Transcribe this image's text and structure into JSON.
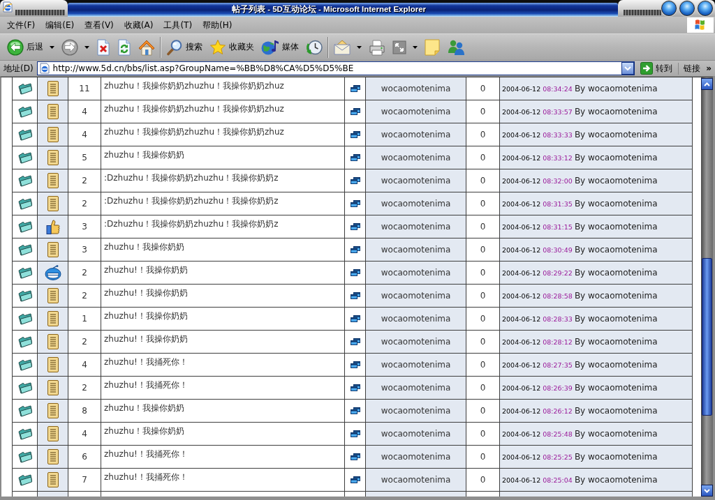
{
  "window": {
    "title": "帖子列表 - 5D互动论坛 - Microsoft Internet Explorer"
  },
  "menu_bar": {
    "items": [
      "文件(F)",
      "编辑(E)",
      "查看(V)",
      "收藏(A)",
      "工具(T)",
      "帮助(H)"
    ]
  },
  "toolbar": {
    "items": [
      {
        "kind": "back",
        "label": "后退",
        "dropdown": true,
        "disabled": false
      },
      {
        "kind": "forward",
        "dropdown": true,
        "disabled": true
      },
      {
        "kind": "stop",
        "dropdown": false,
        "disabled": false
      },
      {
        "kind": "refresh",
        "dropdown": false,
        "disabled": false
      },
      {
        "kind": "home",
        "dropdown": false,
        "disabled": false
      },
      {
        "kind": "separator"
      },
      {
        "kind": "search",
        "label": "搜索",
        "dropdown": false,
        "disabled": false
      },
      {
        "kind": "favorites",
        "label": "收藏夹",
        "dropdown": false,
        "disabled": false
      },
      {
        "kind": "media",
        "label": "媒体",
        "dropdown": false,
        "disabled": false
      },
      {
        "kind": "history",
        "dropdown": false,
        "disabled": false
      },
      {
        "kind": "separator"
      },
      {
        "kind": "mail",
        "dropdown": true,
        "disabled": false
      },
      {
        "kind": "print",
        "dropdown": false,
        "disabled": false
      },
      {
        "kind": "expand",
        "dropdown": true,
        "disabled": true
      },
      {
        "kind": "note",
        "dropdown": false,
        "disabled": false
      },
      {
        "kind": "messenger",
        "dropdown": false,
        "disabled": false
      }
    ]
  },
  "address_bar": {
    "label": "地址(D)",
    "url": "http://www.5d.cn/bbs/list.asp?GroupName=%BB%D8%CA%D5%D5%BE",
    "go_label": "转到",
    "links_label": "链接",
    "more_links": "»"
  },
  "topics": [
    {
      "kind": "normal",
      "column_3": "11",
      "title": "zhuzhu！我操你奶奶zhuzhu！我操你奶奶zhuz",
      "author": "wocaomotenima",
      "column_7": "0",
      "column_8": {
        "date": "2004-06-12",
        "time": "08:34:24",
        "text": "By wocaomotenima"
      }
    },
    {
      "kind": "normal",
      "column_3": "4",
      "title": "zhuzhu！我操你奶奶zhuzhu！我操你奶奶zhuz",
      "author": "wocaomotenima",
      "column_7": "0",
      "column_8": {
        "date": "2004-06-12",
        "time": "08:33:57",
        "text": "By wocaomotenima"
      }
    },
    {
      "kind": "normal",
      "column_3": "4",
      "title": "zhuzhu！我操你奶奶zhuzhu！我操你奶奶zhuz",
      "author": "wocaomotenima",
      "column_7": "0",
      "column_8": {
        "date": "2004-06-12",
        "time": "08:33:33",
        "text": "By wocaomotenima"
      }
    },
    {
      "kind": "normal",
      "column_3": "5",
      "title": "zhuzhu！我操你奶奶",
      "author": "wocaomotenima",
      "column_7": "0",
      "column_8": {
        "date": "2004-06-12",
        "time": "08:33:12",
        "text": "By wocaomotenima"
      }
    },
    {
      "kind": "normal",
      "column_3": "2",
      "title": ":Dzhuzhu！我操你奶奶zhuzhu！我操你奶奶z",
      "author": "wocaomotenima",
      "column_7": "0",
      "column_8": {
        "date": "2004-06-12",
        "time": "08:32:00",
        "text": "By wocaomotenima"
      }
    },
    {
      "kind": "normal",
      "column_3": "2",
      "title": ":Dzhuzhu！我操你奶奶zhuzhu！我操你奶奶z",
      "author": "wocaomotenima",
      "column_7": "0",
      "column_8": {
        "date": "2004-06-12",
        "time": "08:31:35",
        "text": "By wocaomotenima"
      }
    },
    {
      "kind": "thumbs_up",
      "column_3": "3",
      "title": ":Dzhuzhu！我操你奶奶zhuzhu！我操你奶奶z",
      "author": "wocaomotenima",
      "column_7": "0",
      "column_8": {
        "date": "2004-06-12",
        "time": "08:31:15",
        "text": "By wocaomotenima"
      }
    },
    {
      "kind": "normal",
      "column_3": "3",
      "title": "zhuzhu！我操你奶奶",
      "author": "wocaomotenima",
      "column_7": "0",
      "column_8": {
        "date": "2004-06-12",
        "time": "08:30:49",
        "text": "By wocaomotenima"
      }
    },
    {
      "kind": "laughing",
      "column_3": "2",
      "title": "zhuzhu!！我操你奶奶",
      "author": "wocaomotenima",
      "column_7": "0",
      "column_8": {
        "date": "2004-06-12",
        "time": "08:29:22",
        "text": "By wocaomotenima"
      }
    },
    {
      "kind": "normal",
      "column_3": "2",
      "title": "zhuzhu!！我操你奶奶",
      "author": "wocaomotenima",
      "column_7": "0",
      "column_8": {
        "date": "2004-06-12",
        "time": "08:28:58",
        "text": "By wocaomotenima"
      }
    },
    {
      "kind": "normal",
      "column_3": "1",
      "title": "zhuzhu!！我操你奶奶",
      "author": "wocaomotenima",
      "column_7": "0",
      "column_8": {
        "date": "2004-06-12",
        "time": "08:28:33",
        "text": "By wocaomotenima"
      }
    },
    {
      "kind": "normal",
      "column_3": "2",
      "title": "zhuzhu!！我操你奶奶",
      "author": "wocaomotenima",
      "column_7": "0",
      "column_8": {
        "date": "2004-06-12",
        "time": "08:28:12",
        "text": "By wocaomotenima"
      }
    },
    {
      "kind": "normal",
      "column_3": "4",
      "title": "zhuzhu!！我捅死你！",
      "author": "wocaomotenima",
      "column_7": "0",
      "column_8": {
        "date": "2004-06-12",
        "time": "08:27:35",
        "text": "By wocaomotenima"
      }
    },
    {
      "kind": "normal",
      "column_3": "2",
      "title": "zhuzhu!！我捅死你！",
      "author": "wocaomotenima",
      "column_7": "0",
      "column_8": {
        "date": "2004-06-12",
        "time": "08:26:39",
        "text": "By wocaomotenima"
      }
    },
    {
      "kind": "normal",
      "column_3": "8",
      "title": "zhuzhu！我操你奶奶",
      "author": "wocaomotenima",
      "column_7": "0",
      "column_8": {
        "date": "2004-06-12",
        "time": "08:26:12",
        "text": "By wocaomotenima"
      }
    },
    {
      "kind": "normal",
      "column_3": "4",
      "title": "zhuzhu！我操你奶奶",
      "author": "wocaomotenima",
      "column_7": "0",
      "column_8": {
        "date": "2004-06-12",
        "time": "08:25:48",
        "text": "By wocaomotenima"
      }
    },
    {
      "kind": "normal",
      "column_3": "6",
      "title": "zhuzhu!！我捅死你！",
      "author": "wocaomotenima",
      "column_7": "0",
      "column_8": {
        "date": "2004-06-12",
        "time": "08:25:25",
        "text": "By wocaomotenima"
      }
    },
    {
      "kind": "normal",
      "column_3": "7",
      "title": "zhuzhu!！我捅死你！",
      "author": "wocaomotenima",
      "column_7": "0",
      "column_8": {
        "date": "2004-06-12",
        "time": "08:25:04",
        "text": "By wocaomotenima"
      }
    }
  ]
}
